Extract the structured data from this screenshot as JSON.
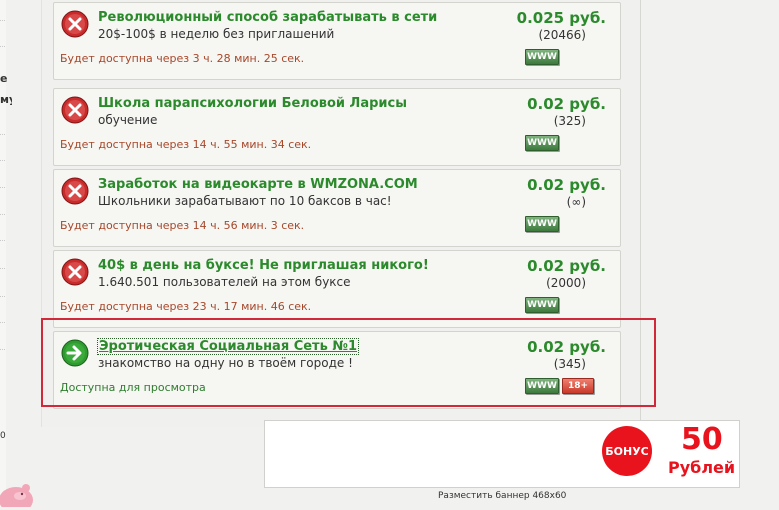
{
  "sidebar": {
    "fragments": [
      "е",
      "му",
      "0"
    ]
  },
  "cards": [
    {
      "title": "Революционный способ зарабатывать в сети",
      "subtitle": "20$-100$ в неделю без приглашений",
      "status": "Будет доступна через 3 ч. 28 мин. 25 сек.",
      "price": "0.025 руб.",
      "count": "(20466)",
      "icon": "x-circle-icon",
      "www_label": "WWW"
    },
    {
      "title": "Школа парапсихологии Беловой Ларисы",
      "subtitle": "обучение",
      "status": "Будет доступна через 14 ч. 55 мин. 34 сек.",
      "price": "0.02 руб.",
      "count": "(325)",
      "icon": "x-circle-icon",
      "www_label": "WWW"
    },
    {
      "title": "Заработок на видеокарте в WMZONA.COM",
      "subtitle": "Школьники зарабатывают по 10 баксов в час!",
      "status": "Будет доступна через 14 ч. 56 мин. 3 сек.",
      "price": "0.02 руб.",
      "count": "(∞)",
      "icon": "x-circle-icon",
      "www_label": "WWW"
    },
    {
      "title": "40$ в день на буксе! Не приглашая никого!",
      "subtitle": "1.640.501 пользователей на этом буксе",
      "status": "Будет доступна через 23 ч. 17 мин. 46 сек.",
      "price": "0.02 руб.",
      "count": "(2000)",
      "icon": "x-circle-icon",
      "www_label": "WWW"
    },
    {
      "title": "Эротическая Социальная Сеть №1",
      "subtitle": "знакомство на одну но в твоём городе !",
      "status": "Доступна для просмотра",
      "price": "0.02 руб.",
      "count": "(345)",
      "icon": "arrow-right-circle-icon",
      "www_label": "WWW",
      "adult_label": "18+"
    }
  ],
  "banner": {
    "bonus_label": "БОНУС",
    "amount": "50",
    "unit": "Рублей",
    "caption": "Разместить баннер 468x60"
  },
  "colors": {
    "accent_green": "#2b8a2b",
    "status_red": "#a6482a",
    "highlight_red": "#d1293a",
    "bonus_red": "#e8131d"
  }
}
